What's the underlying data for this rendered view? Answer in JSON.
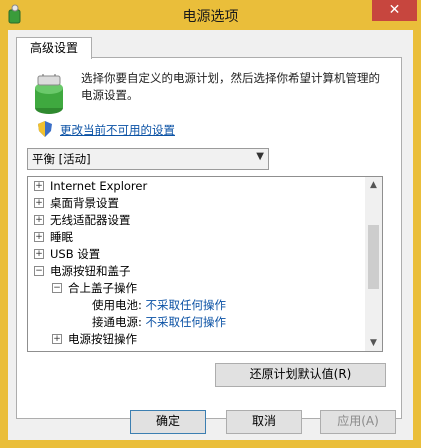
{
  "window": {
    "title": "电源选项",
    "close_label": "✕"
  },
  "tabs": [
    {
      "label": "高级设置"
    }
  ],
  "description": "选择你要自定义的电源计划，然后选择你希望计算机管理的电源设置。",
  "change_link": "更改当前不可用的设置",
  "plan_select": {
    "value": "平衡 [活动]"
  },
  "tree": {
    "items": [
      {
        "expander": "+",
        "label": "Internet Explorer"
      },
      {
        "expander": "+",
        "label": "桌面背景设置"
      },
      {
        "expander": "+",
        "label": "无线适配器设置"
      },
      {
        "expander": "+",
        "label": "睡眠"
      },
      {
        "expander": "+",
        "label": "USB 设置"
      },
      {
        "expander": "−",
        "label": "电源按钮和盖子"
      },
      {
        "expander": "−",
        "label": "合上盖子操作"
      },
      {
        "label": "使用电池:",
        "value": "不采取任何操作"
      },
      {
        "label": "接通电源:",
        "value": "不采取任何操作"
      },
      {
        "expander": "+",
        "label": "电源按钮操作"
      }
    ]
  },
  "buttons": {
    "restore": "还原计划默认值(R)",
    "ok": "确定",
    "cancel": "取消",
    "apply": "应用(A)"
  }
}
